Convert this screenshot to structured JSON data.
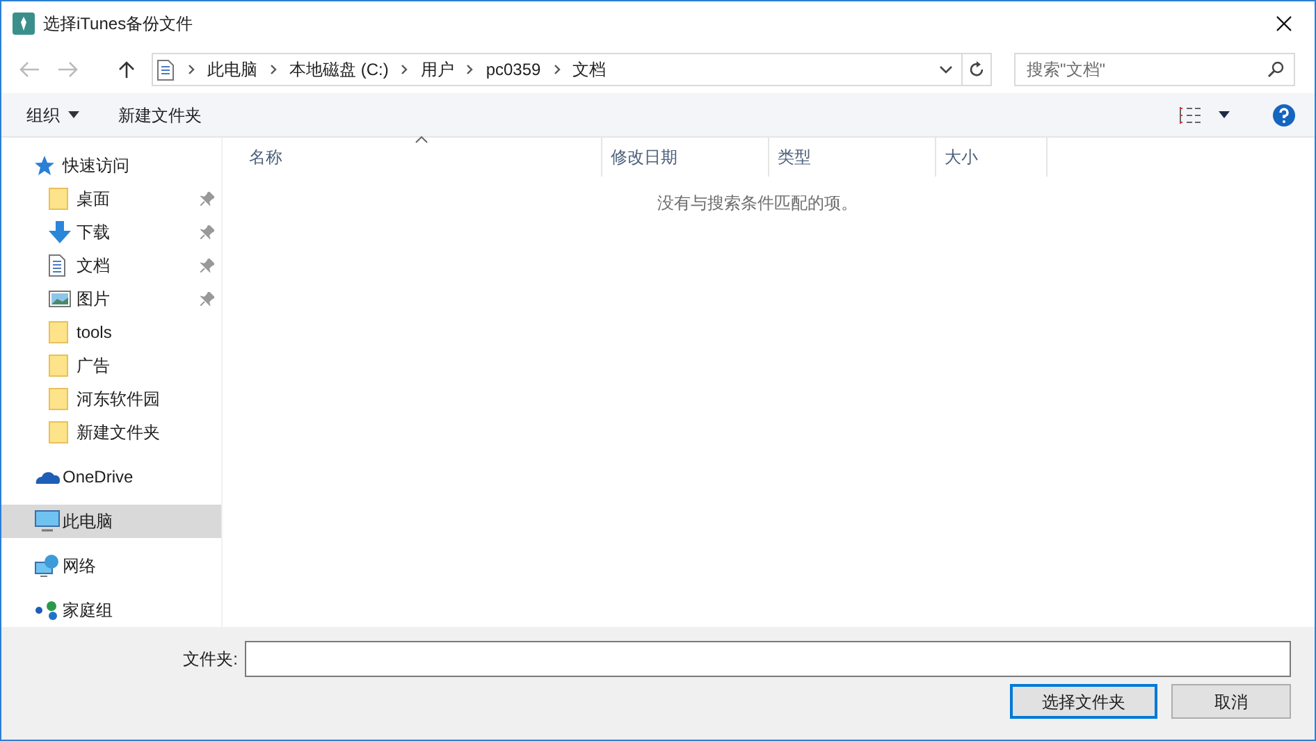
{
  "window": {
    "title": "选择iTunes备份文件"
  },
  "address": {
    "crumbs": [
      "此电脑",
      "本地磁盘 (C:)",
      "用户",
      "pc0359",
      "文档"
    ]
  },
  "search": {
    "placeholder": "搜索\"文档\""
  },
  "toolbar": {
    "organize": "组织",
    "new_folder": "新建文件夹"
  },
  "sidebar": {
    "items": [
      {
        "label": "快速访问",
        "kind": "quick",
        "selected": false,
        "children": [
          {
            "label": "桌面",
            "kind": "folder",
            "pinned": true,
            "selected": false
          },
          {
            "label": "下载",
            "kind": "download",
            "pinned": true,
            "selected": false
          },
          {
            "label": "文档",
            "kind": "document",
            "pinned": true,
            "selected": false
          },
          {
            "label": "图片",
            "kind": "pictures",
            "pinned": true,
            "selected": false
          },
          {
            "label": "tools",
            "kind": "folder",
            "pinned": false,
            "selected": false
          },
          {
            "label": "广告",
            "kind": "folder",
            "pinned": false,
            "selected": false
          },
          {
            "label": "河东软件园",
            "kind": "folder",
            "pinned": false,
            "selected": false
          },
          {
            "label": "新建文件夹",
            "kind": "folder",
            "pinned": false,
            "selected": false
          }
        ]
      },
      {
        "label": "OneDrive",
        "kind": "onedrive",
        "selected": false
      },
      {
        "label": "此电脑",
        "kind": "pc",
        "selected": true
      },
      {
        "label": "网络",
        "kind": "network",
        "selected": false
      },
      {
        "label": "家庭组",
        "kind": "homegroup",
        "selected": false
      }
    ]
  },
  "columns": [
    {
      "label": "名称",
      "sorted": true
    },
    {
      "label": "修改日期",
      "sorted": false
    },
    {
      "label": "类型",
      "sorted": false
    },
    {
      "label": "大小",
      "sorted": false
    }
  ],
  "empty_message": "没有与搜索条件匹配的项。",
  "footer": {
    "folder_label": "文件夹:"
  },
  "buttons": [
    {
      "label": "选择文件夹",
      "default": true
    },
    {
      "label": "取消",
      "default": false
    }
  ]
}
